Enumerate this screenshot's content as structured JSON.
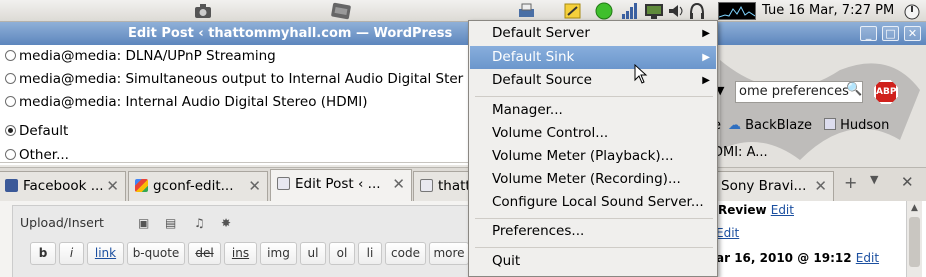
{
  "panel": {
    "clock": "Tue 16 Mar,  7:27 PM"
  },
  "window": {
    "title": "Edit Post ‹ thattommyhall.com — WordPress"
  },
  "sinks": [
    {
      "label": "media@media: DLNA/UPnP Streaming",
      "selected": false
    },
    {
      "label": "media@media: Simultaneous output to Internal Audio Digital Ster",
      "selected": false
    },
    {
      "label": "media@media: Internal Audio Digital Stereo (HDMI)",
      "selected": false
    }
  ],
  "sink_default": {
    "label": "Default",
    "selected": true
  },
  "sink_other": {
    "label": "Other...",
    "selected": false
  },
  "tabs": [
    {
      "label": "Facebook ...",
      "active": false
    },
    {
      "label": "gconf-edit...",
      "active": false
    },
    {
      "label": "Edit Post ‹ ...",
      "active": true
    },
    {
      "label": "thatt",
      "active": false
    }
  ],
  "right_tab": {
    "label": "Sony Bravi..."
  },
  "editor": {
    "upload_label": "Upload/Insert",
    "quicktags": [
      "b",
      "i",
      "link",
      "b-quote",
      "del",
      "ins",
      "img",
      "ul",
      "ol",
      "li",
      "code",
      "more"
    ]
  },
  "right": {
    "search_value": "ome preferences",
    "abp": "ABP",
    "bookmark_backblaze": "BackBlaze",
    "bookmark_hudson": "Hudson",
    "hdmi_fragment": "DMI: A...",
    "review_label": "Review",
    "edit_1": "Edit",
    "edit_2": "Edit",
    "date_text": "ar 16, 2010 @ 19:12",
    "edit_3": "Edit"
  },
  "menu": {
    "default_server": "Default Server",
    "default_sink": "Default Sink",
    "default_source": "Default Source",
    "manager": "Manager...",
    "volume_control": "Volume Control...",
    "volume_meter_playback": "Volume Meter (Playback)...",
    "volume_meter_recording": "Volume Meter (Recording)...",
    "configure": "Configure Local Sound Server...",
    "preferences": "Preferences...",
    "quit": "Quit"
  },
  "colors": {
    "menu_highlight": "#7aa2d4",
    "titlebar": "#6f94c6",
    "abp_red": "#d0211c"
  }
}
